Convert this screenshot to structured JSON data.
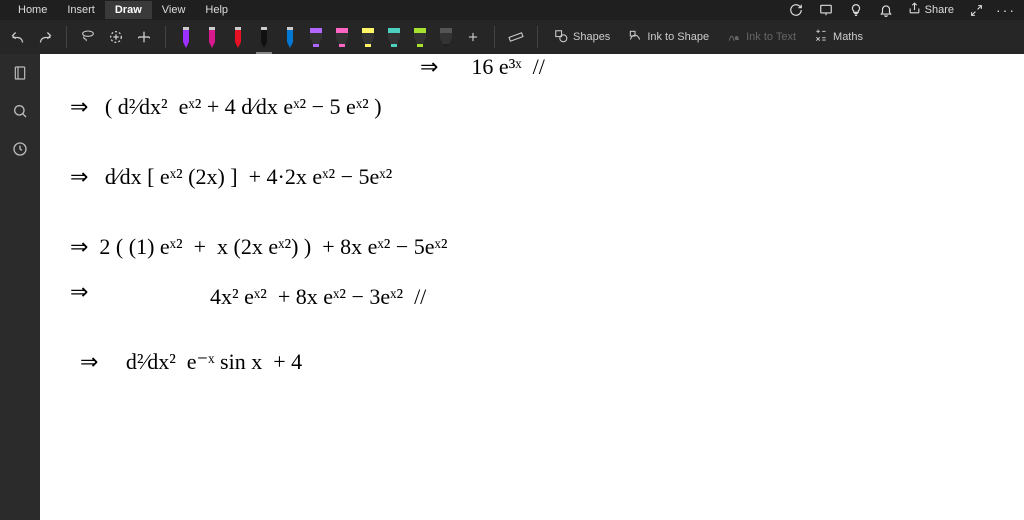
{
  "menu": {
    "items": [
      "Home",
      "Insert",
      "Draw",
      "View",
      "Help"
    ],
    "active_index": 2,
    "share_label": "Share"
  },
  "ribbon": {
    "shapes_label": "Shapes",
    "ink_to_shape_label": "Ink to Shape",
    "ink_to_text_label": "Ink to Text",
    "maths_label": "Maths"
  },
  "pens": [
    {
      "name": "pen-purple",
      "color": "#9b30ff"
    },
    {
      "name": "pen-magenta",
      "color": "#d61a8c"
    },
    {
      "name": "pen-red",
      "color": "#e81123"
    },
    {
      "name": "pen-black",
      "color": "#111111"
    },
    {
      "name": "pen-blue",
      "color": "#0078d4"
    }
  ],
  "selected_pen_index": 3,
  "highlighters": [
    {
      "name": "hl-purple",
      "color": "#b266ff"
    },
    {
      "name": "hl-pink",
      "color": "#ff66c4"
    },
    {
      "name": "hl-yellow",
      "color": "#fff566"
    },
    {
      "name": "hl-teal",
      "color": "#4dd0c0"
    },
    {
      "name": "hl-green",
      "color": "#a6e22e"
    },
    {
      "name": "hl-black",
      "color": "#222222"
    }
  ],
  "handwriting": {
    "line0": "⇒      16 e³ˣ  //",
    "line1": "⇒   ( d²⁄dx²  eˣ² + 4 d⁄dx eˣ² − 5 eˣ² )",
    "line2": "⇒   d⁄dx [ eˣ² (2x) ]  + 4·2x eˣ² − 5eˣ²",
    "line3": "⇒  2 ( (1) eˣ²  +  x (2x eˣ²) )  + 8x eˣ² − 5eˣ²",
    "line4": "⇒",
    "line4b": "4x² eˣ²  + 8x eˣ² − 3eˣ²  //",
    "line5": "⇒     d²⁄dx²  e⁻ˣ sin x  + 4"
  }
}
